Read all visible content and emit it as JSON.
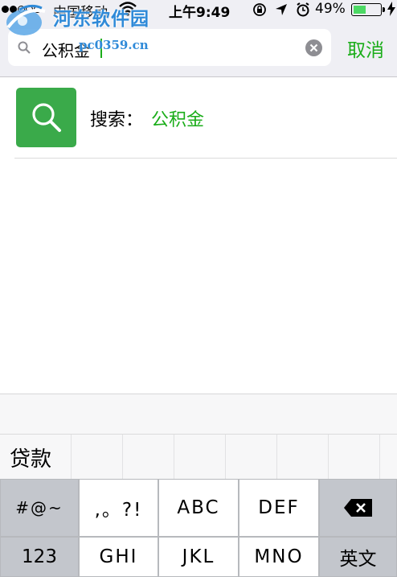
{
  "status_bar": {
    "carrier": "中国移动",
    "time": "上午9:49",
    "battery_percent": "49%",
    "battery_level": 0.49,
    "icons": [
      "signal-dots-icon",
      "wifi-icon",
      "rotation-lock-icon",
      "location-arrow-icon",
      "alarm-icon",
      "battery-icon",
      "charging-icon"
    ]
  },
  "watermark": {
    "title": "河东软件园",
    "url": "pc0359.cn"
  },
  "search": {
    "value": "公积金",
    "cancel_label": "取消"
  },
  "result": {
    "prefix": "搜索：",
    "keyword": "公积金"
  },
  "keyboard": {
    "candidates": [
      "贷款"
    ],
    "row1": [
      "#@~",
      ",。?!",
      "ABC",
      "DEF"
    ],
    "row2": [
      "123",
      "GHI",
      "JKL",
      "MNO",
      "英文"
    ],
    "colors": {
      "accent": "#1aad19",
      "result_icon_bg": "#3aaa4a"
    }
  }
}
